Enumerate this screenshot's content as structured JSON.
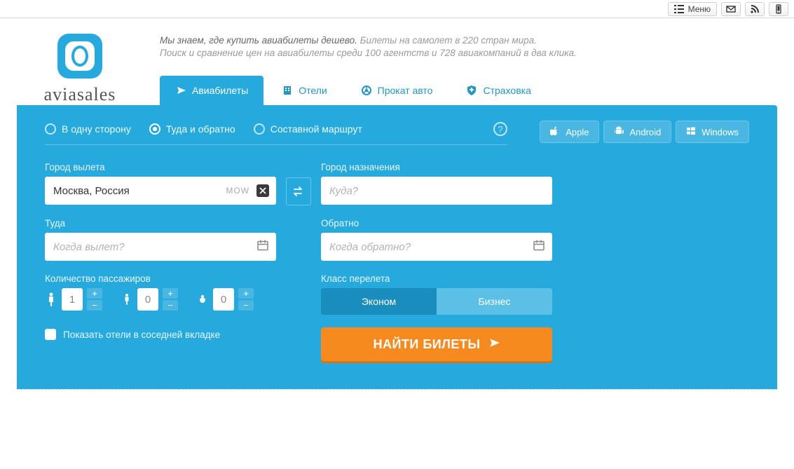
{
  "toolbar": {
    "menu_label": "Меню"
  },
  "brand": {
    "name": "aviasales"
  },
  "tagline": {
    "main": "Мы знаем, где купить авиабилеты дешево.",
    "rest": "Билеты на самолет в 220 стран мира.",
    "sub": "Поиск и сравнение цен на авиабилеты среди 100 агентств и 728 авиакомпаний в два клика."
  },
  "tabs": {
    "flights": "Авиабилеты",
    "hotels": "Отели",
    "cars": "Прокат авто",
    "insurance": "Страховка"
  },
  "trip_type": {
    "one_way": "В одну сторону",
    "round": "Туда и обратно",
    "multi": "Составной маршрут"
  },
  "apps": {
    "apple": "Apple",
    "android": "Android",
    "windows": "Windows"
  },
  "form": {
    "origin_label": "Город вылета",
    "origin_value": "Москва, Россия",
    "origin_code": "MOW",
    "dest_label": "Город назначения",
    "dest_placeholder": "Куда?",
    "depart_label": "Туда",
    "depart_placeholder": "Когда вылет?",
    "return_label": "Обратно",
    "return_placeholder": "Когда обратно?",
    "pax_label": "Количество пассажиров",
    "adults": "1",
    "children": "0",
    "infants": "0",
    "class_label": "Класс перелета",
    "class_economy": "Эконом",
    "class_business": "Бизнес",
    "show_hotels": "Показать отели в соседней вкладке",
    "search": "НАЙТИ БИЛЕТЫ"
  }
}
